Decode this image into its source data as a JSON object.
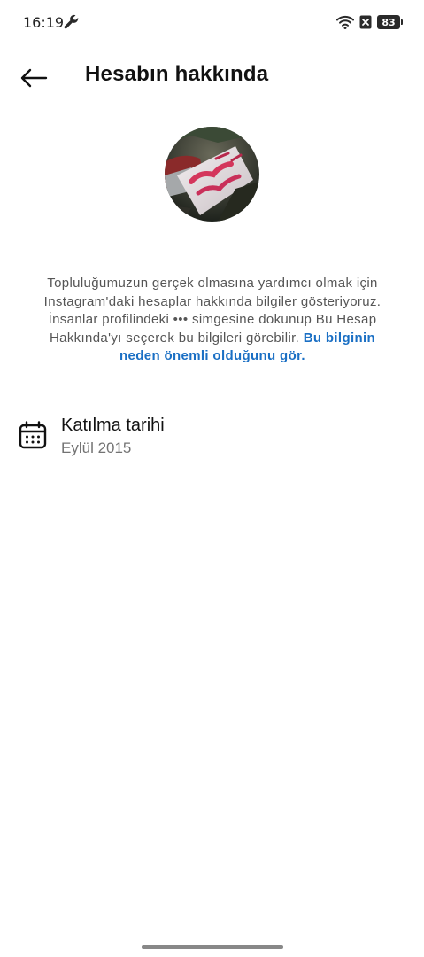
{
  "status_bar": {
    "time": "16:19",
    "battery_level": "83",
    "icons": [
      "wrench-icon",
      "wifi-icon",
      "sim-off-icon",
      "battery-icon"
    ]
  },
  "header": {
    "back_icon": "arrow-left-icon",
    "title": "Hesabın hakkında"
  },
  "description": {
    "text": "Topluluğumuzun gerçek olmasına yardımcı olmak için Instagram'daki hesaplar hakkında bilgiler gösteriyoruz. İnsanlar profilindeki ••• simgesine dokunup Bu Hesap Hakkında'yı seçerek bu bilgileri görebilir. ",
    "link": "Bu bilginin neden önemli olduğunu gör."
  },
  "joined": {
    "icon": "calendar-icon",
    "label": "Katılma tarihi",
    "value": "Eylül 2015"
  },
  "colors": {
    "link": "#1a6fc4",
    "secondary_text": "#737373",
    "background": "#ffffff"
  }
}
